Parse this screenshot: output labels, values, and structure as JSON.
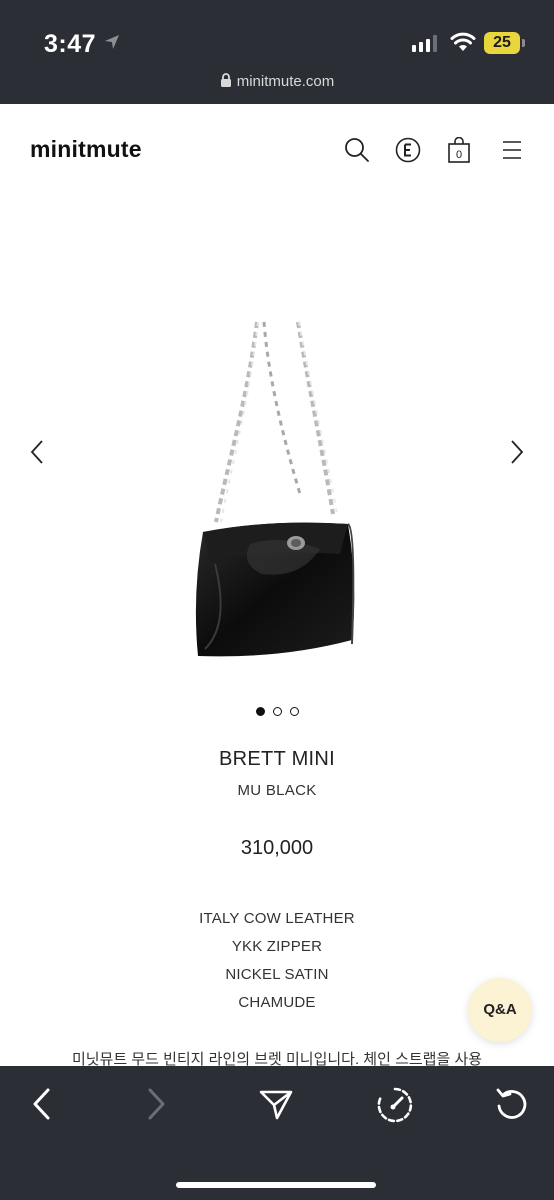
{
  "status_bar": {
    "time": "3:47",
    "battery": "25"
  },
  "browser": {
    "url": "minitmute.com"
  },
  "site": {
    "brand": "minitmute",
    "header_icons": [
      "search-icon",
      "e-icon",
      "cart-icon",
      "menu-icon"
    ],
    "cart_count": "0"
  },
  "product": {
    "name": "BRETT MINI",
    "color": "MU BLACK",
    "price": "310,000",
    "specs": [
      "ITALY COW LEATHER",
      "YKK ZIPPER",
      "NICKEL SATIN",
      "CHAMUDE"
    ],
    "description": "미닛뮤트 무드 빈티지 라인의 브렛 미니입니다. 체인 스트랩을 사용",
    "gallery_total": 3,
    "gallery_active": 1
  },
  "qa_button": {
    "label": "Q&A"
  },
  "toolbar": {
    "icons": [
      "back-icon",
      "forward-icon",
      "share-icon",
      "speed-dial-icon",
      "reload-icon"
    ]
  }
}
